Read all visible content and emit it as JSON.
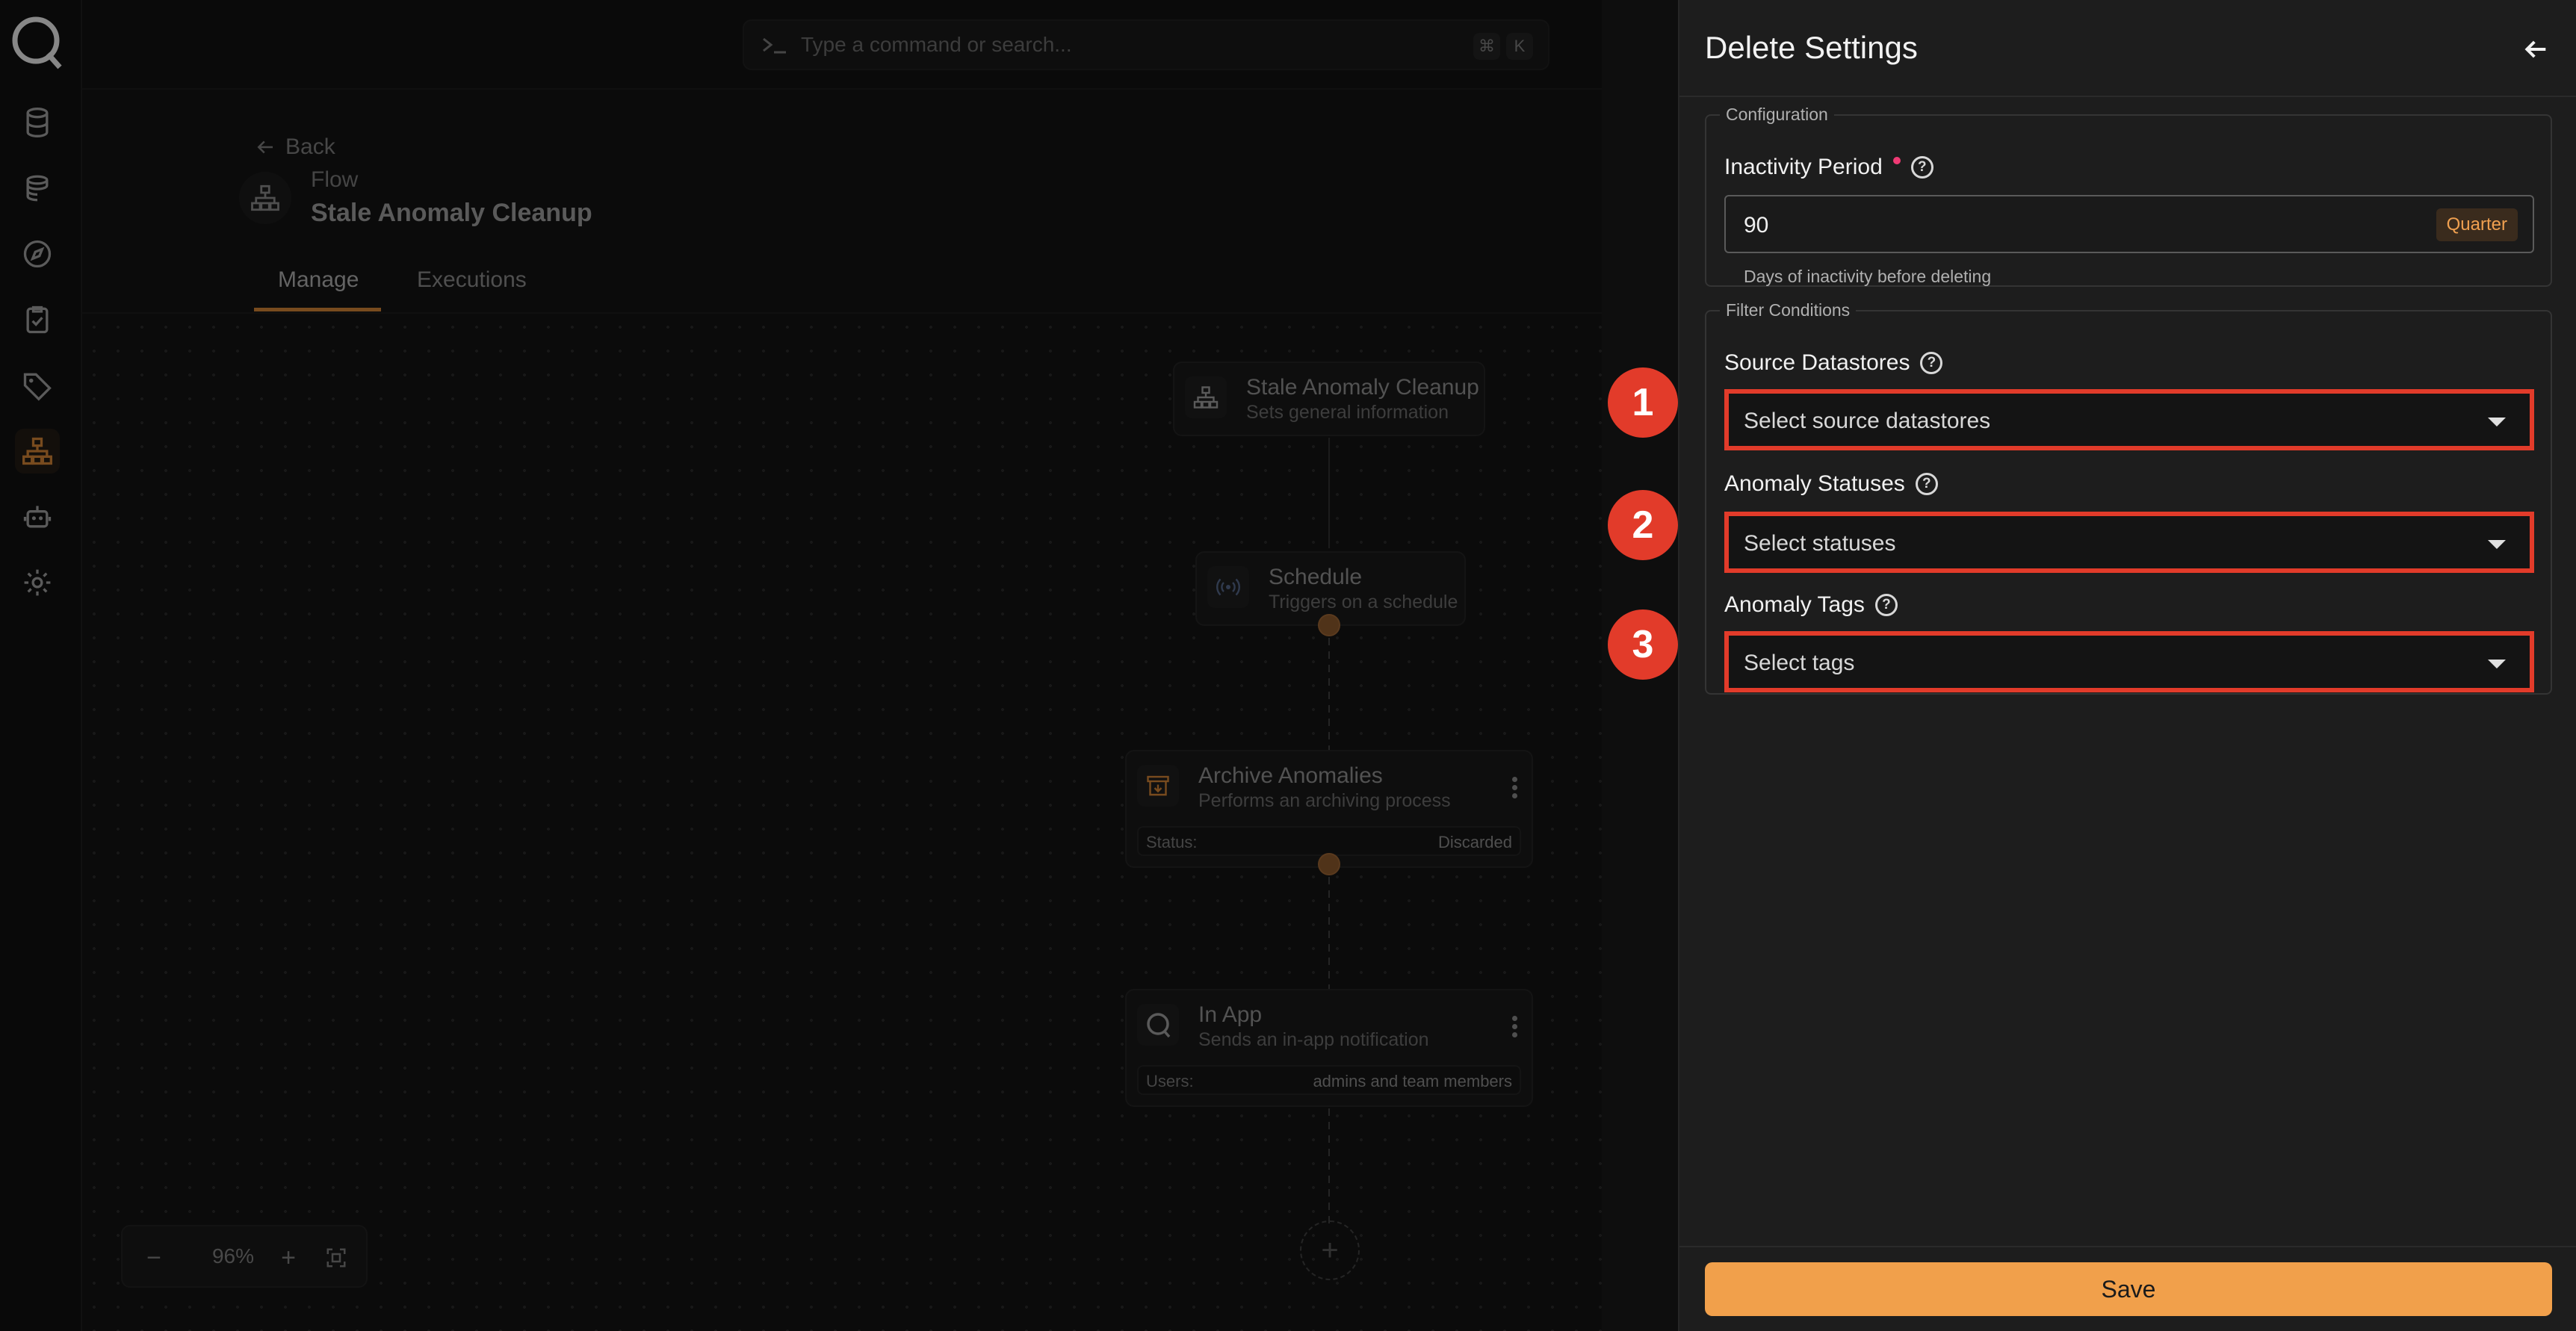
{
  "command": {
    "placeholder": "Type a command or search...",
    "kbd_cmd": "⌘",
    "kbd_k": "K"
  },
  "sidebar": {
    "items": [
      {
        "icon": "database-icon"
      },
      {
        "icon": "datastores-icon"
      },
      {
        "icon": "explore-icon"
      },
      {
        "icon": "checks-icon"
      },
      {
        "icon": "tag-icon"
      },
      {
        "icon": "flows-icon",
        "active": true
      },
      {
        "icon": "agent-icon"
      },
      {
        "icon": "settings-icon"
      }
    ]
  },
  "header": {
    "back": "Back",
    "subtitle": "Flow",
    "title": "Stale Anomaly Cleanup"
  },
  "tabs": [
    {
      "label": "Manage",
      "active": true
    },
    {
      "label": "Executions"
    }
  ],
  "flow_nodes": {
    "n1": {
      "title": "Stale Anomaly Cleanup",
      "subtitle": "Sets general information"
    },
    "n2": {
      "title": "Schedule",
      "subtitle": "Triggers on a schedule"
    },
    "n3": {
      "title": "Archive Anomalies",
      "subtitle": "Performs an archiving process",
      "meta_key": "Status:",
      "meta_value": "Discarded"
    },
    "n4": {
      "title": "In App",
      "subtitle": "Sends an in-app notification",
      "meta_key": "Users:",
      "meta_value": "admins and team members"
    }
  },
  "zoom": {
    "minus": "−",
    "value": "96%",
    "plus": "+"
  },
  "panel": {
    "title": "Delete Settings",
    "configuration": {
      "legend": "Configuration",
      "inactivity_label": "Inactivity Period",
      "inactivity_value": "90",
      "inactivity_badge": "Quarter",
      "inactivity_hint": "Days of inactivity before deleting"
    },
    "filters": {
      "legend": "Filter Conditions",
      "source_label": "Source Datastores",
      "source_placeholder": "Select source datastores",
      "status_label": "Anomaly Statuses",
      "status_placeholder": "Select statuses",
      "tags_label": "Anomaly Tags",
      "tags_placeholder": "Select tags"
    },
    "save": "Save"
  },
  "markers": [
    "1",
    "2",
    "3"
  ],
  "colors": {
    "accent": "#f1a04b",
    "highlight": "#e23b2a",
    "required": "#ef3a74"
  }
}
